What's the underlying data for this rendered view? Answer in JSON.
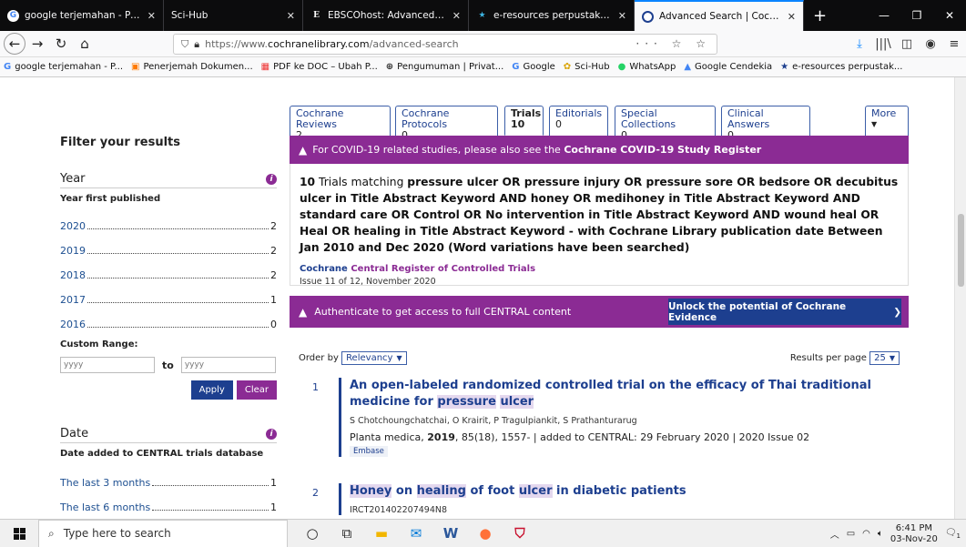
{
  "browser": {
    "tabs": [
      {
        "title": "google terjemahan - Penelusuri",
        "icon": "google-icon",
        "active": false
      },
      {
        "title": "Sci-Hub",
        "icon": "none",
        "active": false
      },
      {
        "title": "EBSCOhost: Advanced Search",
        "icon": "ebsco-icon",
        "active": false
      },
      {
        "title": "e-resources perpustakaan nasio",
        "icon": "star-icon",
        "active": false
      },
      {
        "title": "Advanced Search | Cochrane Li",
        "icon": "cochrane-icon",
        "active": true
      }
    ],
    "url_prefix": "https://www.",
    "url_host": "cochranelibrary.com",
    "url_path": "/advanced-search",
    "url_actions": "··· ☆ ☆",
    "bookmarks": [
      {
        "label": "google terjemahan - P...",
        "icon": "G"
      },
      {
        "label": "Penerjemah Dokumen...",
        "icon": "▣"
      },
      {
        "label": "PDF ke DOC – Ubah P...",
        "icon": "▦"
      },
      {
        "label": "Pengumuman | Privat...",
        "icon": "⊕"
      },
      {
        "label": "Google",
        "icon": "G"
      },
      {
        "label": "Sci-Hub",
        "icon": "✿"
      },
      {
        "label": "WhatsApp",
        "icon": "●"
      },
      {
        "label": "Google Cendekia",
        "icon": "▲"
      },
      {
        "label": "e-resources perpustak...",
        "icon": "★"
      }
    ]
  },
  "sidebar": {
    "title": "Filter your results",
    "year": {
      "heading": "Year",
      "subheading": "Year first published",
      "rows": [
        {
          "label": "2020",
          "count": "2"
        },
        {
          "label": "2019",
          "count": "2"
        },
        {
          "label": "2018",
          "count": "2"
        },
        {
          "label": "2017",
          "count": "1"
        },
        {
          "label": "2016",
          "count": "0"
        }
      ],
      "custom_range_label": "Custom Range:",
      "from_placeholder": "yyyy",
      "to_label": "to",
      "to_placeholder": "yyyy",
      "apply_label": "Apply",
      "clear_label": "Clear"
    },
    "date": {
      "heading": "Date",
      "subheading": "Date added to CENTRAL trials database",
      "rows": [
        {
          "label": "The last 3 months",
          "count": "1"
        },
        {
          "label": "The last 6 months",
          "count": "1"
        }
      ]
    }
  },
  "content_tabs": [
    {
      "label": "Cochrane Reviews",
      "count": "2"
    },
    {
      "label": "Cochrane Protocols",
      "count": "0"
    },
    {
      "label": "Trials",
      "count": "10"
    },
    {
      "label": "Editorials",
      "count": "0"
    },
    {
      "label": "Special Collections",
      "count": "0"
    },
    {
      "label": "Clinical Answers",
      "count": "0"
    },
    {
      "label": "More",
      "count": ""
    }
  ],
  "covid_banner": {
    "text": "For COVID-19 related studies, please also see the ",
    "link": "Cochrane COVID-19 Study Register"
  },
  "summary": {
    "count": "10",
    "prefix": " Trials matching ",
    "query": "pressure ulcer OR pressure injury OR pressure sore OR bedsore OR decubitus ulcer in Title Abstract Keyword AND honey OR medihoney in Title Abstract Keyword AND standard care OR Control OR No intervention in Title Abstract Keyword AND wound heal OR Heal OR healing in Title Abstract Keyword - with Cochrane Library publication date Between Jan 2010 and Dec 2020 (Word variations have been searched)",
    "db_brand": "Cochrane",
    "db_name": " Central Register of Controlled Trials",
    "issue": "Issue 11 of 12, November 2020"
  },
  "auth_banner": {
    "text": "Authenticate to get access to full CENTRAL content",
    "button": "Unlock the potential of Cochrane Evidence"
  },
  "order": {
    "label": "Order by",
    "value": "Relevancy",
    "per_page_label": "Results per page",
    "per_page_value": "25"
  },
  "results": [
    {
      "num": "1",
      "title_parts": [
        "An open-labeled randomized controlled trial on the efficacy of Thai traditional medicine for ",
        "pressure",
        " ",
        "ulcer"
      ],
      "authors": "S Chotchoungchatchai, O Krairit, P Tragulpiankit, S Prathanturarug",
      "source_journal": "Planta medica, ",
      "source_year": "2019",
      "source_rest": ", 85(18), 1557- | added to CENTRAL: 29 February 2020 | 2020 Issue 02",
      "tag": "Embase"
    },
    {
      "num": "2",
      "title_parts": [
        "Honey",
        " on ",
        "healing",
        " of foot ",
        "ulcer",
        " in diabetic patients"
      ],
      "authors": "IRCT201402207494N8"
    }
  ],
  "taskbar": {
    "search_placeholder": "Type here to search",
    "time": "6:41 PM",
    "date": "03-Nov-20",
    "notifications": "1"
  },
  "colors": {
    "purple": "#8b2b94",
    "navy": "#1d3f8f"
  }
}
